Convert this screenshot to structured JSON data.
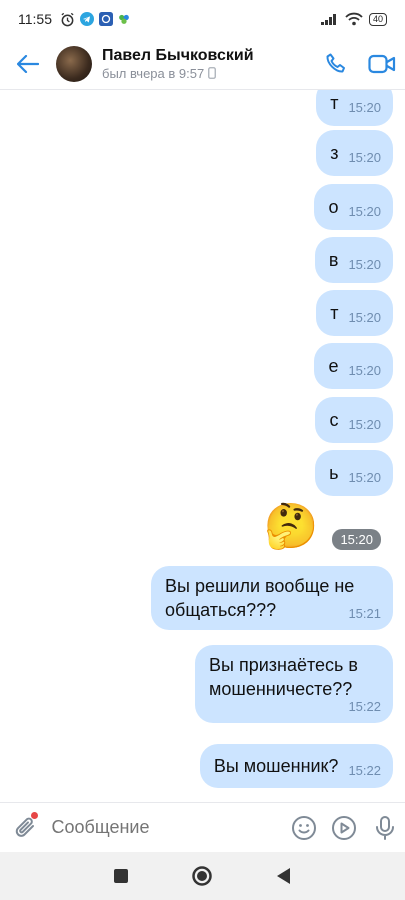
{
  "status_bar": {
    "time": "11:55",
    "battery": "40",
    "icons": [
      "alarm-icon",
      "telegram-icon",
      "mail-icon",
      "app-icon",
      "signal-icon",
      "wifi-icon",
      "battery-icon"
    ]
  },
  "header": {
    "contact_name": "Павел Бычковский",
    "last_seen": "был вчера в 9:57",
    "accent_color": "#2a88e0"
  },
  "messages": [
    {
      "text": "т",
      "time": "15:20"
    },
    {
      "text": "з",
      "time": "15:20"
    },
    {
      "text": "о",
      "time": "15:20"
    },
    {
      "text": "в",
      "time": "15:20"
    },
    {
      "text": "т",
      "time": "15:20"
    },
    {
      "text": "е",
      "time": "15:20"
    },
    {
      "text": "с",
      "time": "15:20"
    },
    {
      "text": "ь",
      "time": "15:20"
    },
    {
      "emoji": "🤔",
      "time": "15:20"
    },
    {
      "text": "Вы решили вообще не общаться???",
      "time": "15:21"
    },
    {
      "text": "Вы признаётесь в мошенничесте??",
      "time": "15:22"
    },
    {
      "text": "Вы мошенник?",
      "time": "15:22"
    }
  ],
  "composer": {
    "placeholder": "Сообщение"
  },
  "colors": {
    "bubble": "#cce4ff",
    "accent": "#2a88e0"
  }
}
